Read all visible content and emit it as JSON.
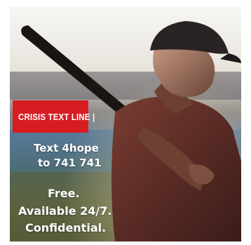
{
  "badge": {
    "label": "CRISIS TEXT LINE |",
    "color": "#d81d22"
  },
  "texting": {
    "line1": "Text 4hope",
    "line2": "to 741 741"
  },
  "message": {
    "line1": "Free.",
    "line2": "Available 24/7.",
    "line3": "Confidential."
  },
  "colors": {
    "text": "#ffffff",
    "background": "#ffffff"
  }
}
